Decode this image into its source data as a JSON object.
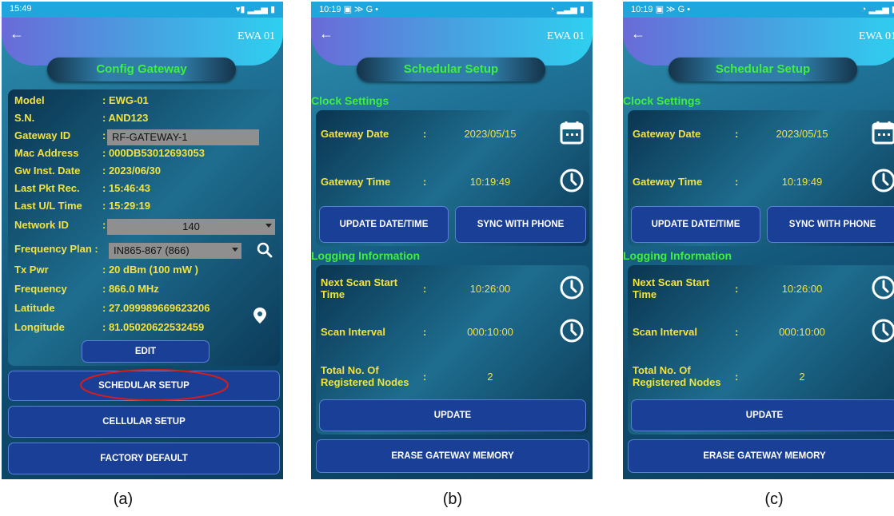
{
  "panels": {
    "a": {
      "status_time": "15:49",
      "device_name": "EWA 01",
      "title": "Config Gateway",
      "fields": [
        {
          "label": "Model",
          "value": ": EWG-01"
        },
        {
          "label": "S.N.",
          "value": ": AND123"
        },
        {
          "label": "Gateway ID",
          "value": "RF-GATEWAY-1"
        },
        {
          "label": "Mac Address",
          "value": ": 000DB53012693053"
        },
        {
          "label": "Gw Inst. Date",
          "value": ": 2023/06/30"
        },
        {
          "label": "Last Pkt Rec.",
          "value": ": 15:46:43"
        },
        {
          "label": "Last U/L Time",
          "value": ": 15:29:19"
        },
        {
          "label": "Network ID",
          "value": "140"
        },
        {
          "label": "Frequency Plan :",
          "value": "IN865-867 (866)"
        },
        {
          "label": "Tx Pwr",
          "value": ": 20 dBm (100 mW )"
        },
        {
          "label": "Frequency",
          "value": ": 866.0 MHz"
        },
        {
          "label": "Latitude",
          "value": ": 27.099989669623206"
        },
        {
          "label": "Longitude",
          "value": ": 81.05020622532459"
        }
      ],
      "edit_button": "EDIT",
      "buttons": [
        "SCHEDULAR SETUP",
        "CELLULAR SETUP",
        "FACTORY DEFAULT"
      ],
      "caption": "(a)"
    },
    "b": {
      "status_time": "10:19",
      "status_extra": "G  •",
      "device_name": "EWA 01",
      "title": "Schedular Setup",
      "clock_section": "Clock Settings",
      "gateway_date_label": "Gateway Date",
      "gateway_date": "2023/05/15",
      "gateway_time_label": "Gateway Time",
      "gateway_time": "10:19:49",
      "update_datetime_button": "UPDATE DATE/TIME",
      "sync_button": "SYNC WITH PHONE",
      "logging_section": "Logging Information",
      "next_scan_label": "Next Scan Start Time",
      "next_scan": "10:26:00",
      "scan_interval_label": "Scan Interval",
      "scan_interval": "000:10:00",
      "total_nodes_label": "Total No. Of Registered Nodes",
      "total_nodes": "2",
      "update_button": "UPDATE",
      "erase_button": "ERASE GATEWAY MEMORY",
      "colon": ":",
      "caption": "(b)"
    },
    "c": {
      "status_time": "10:19",
      "status_extra": "G  •",
      "device_name": "EWA 01",
      "title": "Schedular Setup",
      "clock_section": "Clock Settings",
      "gateway_date_label": "Gateway Date",
      "gateway_date": "2023/05/15",
      "gateway_time_label": "Gateway Time",
      "gateway_time": "10:19:49",
      "update_datetime_button": "UPDATE DATE/TIME",
      "sync_button": "SYNC WITH PHONE",
      "logging_section": "Logging Information",
      "next_scan_label": "Next Scan Start Time",
      "next_scan": "10:26:00",
      "scan_interval_label": "Scan Interval",
      "scan_interval": "000:10:00",
      "total_nodes_label": "Total No. Of Registered Nodes",
      "total_nodes": "2",
      "update_button": "UPDATE",
      "erase_button": "ERASE GATEWAY MEMORY",
      "colon": ":",
      "caption": "(c)"
    }
  },
  "icons": {
    "back": "arrow-left-icon",
    "search": "search-icon",
    "location": "map-pin-icon",
    "calendar": "calendar-icon",
    "clock": "clock-icon"
  },
  "colors": {
    "label_yellow": "#f2e33d",
    "title_green": "#3df03d",
    "button_blue": "#1a3f96",
    "highlight_ellipse": "#d81c1c"
  }
}
